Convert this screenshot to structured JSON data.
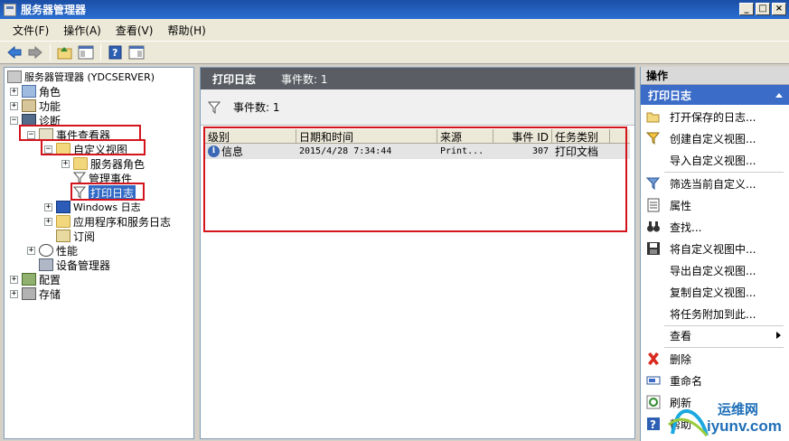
{
  "window": {
    "title": "服务器管理器",
    "buttons": [
      "_",
      "□",
      "×"
    ]
  },
  "menu": [
    "文件(F)",
    "操作(A)",
    "查看(V)",
    "帮助(H)"
  ],
  "tree": {
    "root": "服务器管理器 (YDCSERVER)",
    "roles": "角色",
    "features": "功能",
    "diagnostics": "诊断",
    "event_viewer": "事件查看器",
    "custom_views": "自定义视图",
    "server_roles": "服务器角色",
    "admin_events": "管理事件",
    "print_log": "打印日志",
    "windows_logs": "Windows 日志",
    "app_service_logs": "应用程序和服务日志",
    "subscriptions": "订阅",
    "performance": "性能",
    "device_manager": "设备管理器",
    "configuration": "配置",
    "storage": "存储"
  },
  "center": {
    "title": "打印日志",
    "event_count_label": "事件数: 1",
    "filter_text": "事件数: 1",
    "columns": [
      "级别",
      "日期和时间",
      "来源",
      "事件 ID",
      "任务类别"
    ],
    "rows": [
      {
        "level": "信息",
        "datetime": "2015/4/28 7:34:44",
        "source": "Print...",
        "event_id": "307",
        "category": "打印文档"
      }
    ]
  },
  "actions": {
    "header": "操作",
    "section": "打印日志",
    "items": [
      {
        "label": "打开保存的日志...",
        "icon": "open-folder-icon"
      },
      {
        "label": "创建自定义视图...",
        "icon": "filter-create-icon"
      },
      {
        "label": "导入自定义视图...",
        "icon": "none"
      },
      {
        "label": "筛选当前自定义...",
        "icon": "filter-icon"
      },
      {
        "label": "属性",
        "icon": "properties-icon"
      },
      {
        "label": "查找...",
        "icon": "binoculars-icon"
      },
      {
        "label": "将自定义视图中...",
        "icon": "save-icon"
      },
      {
        "label": "导出自定义视图...",
        "icon": "none"
      },
      {
        "label": "复制自定义视图...",
        "icon": "none"
      },
      {
        "label": "将任务附加到此...",
        "icon": "none"
      },
      {
        "label": "查看",
        "icon": "none"
      },
      {
        "label": "删除",
        "icon": "delete-icon"
      },
      {
        "label": "重命名",
        "icon": "rename-icon"
      },
      {
        "label": "刷新",
        "icon": "refresh-icon"
      },
      {
        "label": "帮助",
        "icon": "help-icon"
      }
    ]
  },
  "watermark": {
    "cn": "运维网",
    "url": "iyunv.com"
  },
  "colors": {
    "title_bar": "#2a6ed1",
    "selection": "#316ac5",
    "highlight_box": "#d4141c",
    "center_header": "#5a5d63"
  }
}
